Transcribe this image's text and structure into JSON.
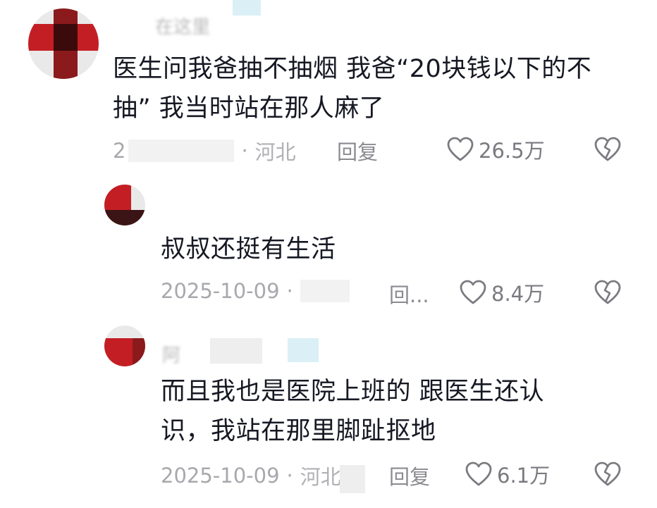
{
  "comments": [
    {
      "username": "在这里",
      "text_line1": "医生问我爸抽不抽烟 我爸“20块钱以下的不",
      "text_line2": "抽” 我当时站在那人麻了",
      "date": "2",
      "region": "河北",
      "reply_label": "回复",
      "likes": "26.5万",
      "avatar_color": "#c41e25"
    },
    {
      "username": "",
      "text_line1": "叔叔还挺有生活",
      "date": "2025-10-09",
      "region": "",
      "reply_label": "回...",
      "likes": "8.4万",
      "avatar_color": "#c41e25"
    },
    {
      "username": "阿",
      "text_line1": "而且我也是医院上班的 跟医生还认",
      "text_line2": "识，我站在那里脚趾抠地",
      "date": "2025-10-09",
      "region": "河北",
      "reply_label": "回复",
      "likes": "6.1万",
      "avatar_color": "#c41e25"
    }
  ],
  "icons": {
    "like": "heart-outline-icon",
    "dislike": "broken-heart-icon"
  },
  "colors": {
    "text_primary": "#161823",
    "text_meta": "#a8a8ad",
    "brand_red": "#c41e25"
  }
}
